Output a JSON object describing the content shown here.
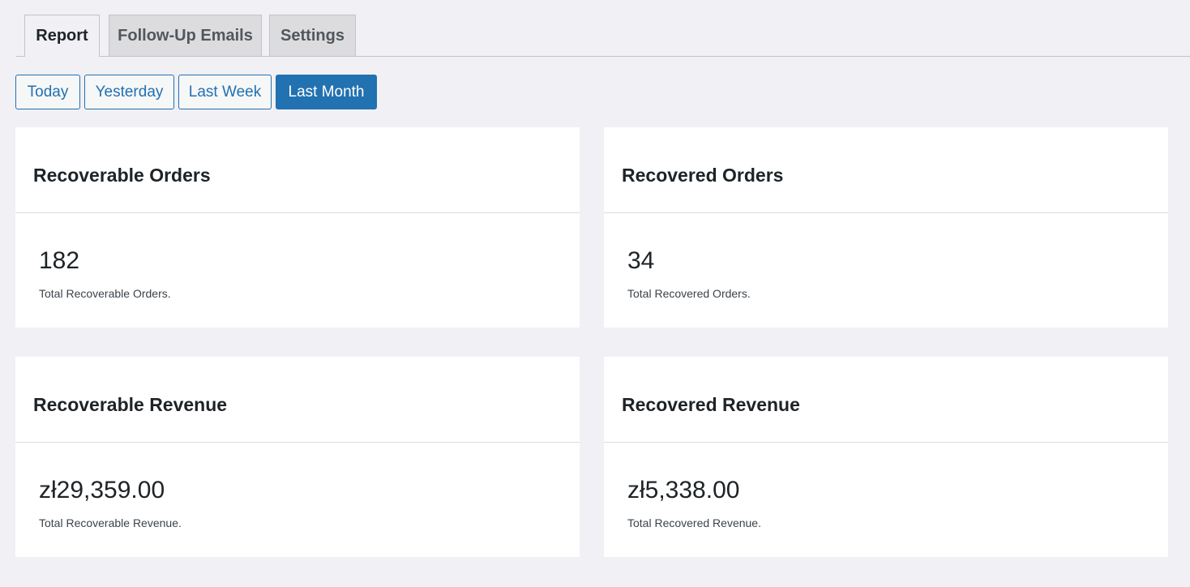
{
  "tabs": {
    "report": "Report",
    "followup": "Follow-Up Emails",
    "settings": "Settings"
  },
  "range": {
    "today": "Today",
    "yesterday": "Yesterday",
    "last_week": "Last Week",
    "last_month": "Last Month",
    "selected": "Last Month"
  },
  "cards": {
    "recoverable_orders": {
      "title": "Recoverable Orders",
      "value": "182",
      "desc": "Total Recoverable Orders."
    },
    "recovered_orders": {
      "title": "Recovered Orders",
      "value": "34",
      "desc": "Total Recovered Orders."
    },
    "recoverable_revenue": {
      "title": "Recoverable Revenue",
      "value": "zł29,359.00",
      "desc": "Total Recoverable Revenue."
    },
    "recovered_revenue": {
      "title": "Recovered Revenue",
      "value": "zł5,338.00",
      "desc": "Total Recovered Revenue."
    }
  },
  "colors": {
    "accent": "#2271b1",
    "background": "#f1f0f4",
    "card": "#ffffff"
  }
}
